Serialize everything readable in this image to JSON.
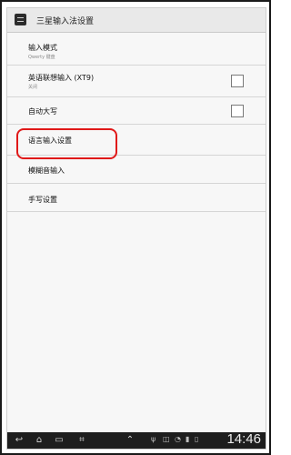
{
  "titlebar": {
    "title": "三星输入法设置",
    "icon": "menu-icon"
  },
  "settings": [
    {
      "label": "输入模式",
      "summary": "Qwerty 键盘"
    },
    {
      "label": "英语联想输入 (XT9)",
      "summary": "关闭",
      "checked": false
    },
    {
      "label": "自动大写",
      "checked": false
    },
    {
      "label": "语言输入设置"
    },
    {
      "label": "模糊音输入"
    },
    {
      "label": "手写设置"
    }
  ],
  "navbar": {
    "clock": "14:46",
    "buttons": [
      "back-icon",
      "home-icon",
      "recent-apps-icon",
      "screenshot-icon",
      "menu-icon"
    ],
    "status_icons": [
      "usb-icon",
      "notification-icon",
      "wifi-icon",
      "signal-icon",
      "battery-icon"
    ]
  },
  "colors": {
    "highlight": "#e01818",
    "navbar": "#1e1e1e"
  }
}
